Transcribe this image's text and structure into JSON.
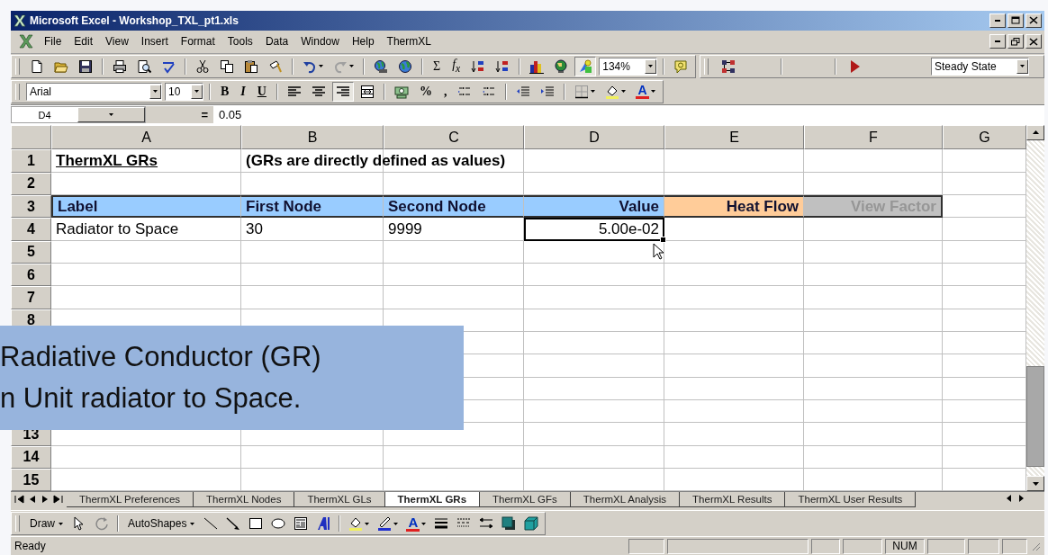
{
  "window": {
    "title": "Microsoft Excel - Workshop_TXL_pt1.xls"
  },
  "menu": [
    "File",
    "Edit",
    "View",
    "Insert",
    "Format",
    "Tools",
    "Data",
    "Window",
    "Help",
    "ThermXL"
  ],
  "standard_toolbar": {
    "sum": "Σ",
    "function": "f$_{x}$",
    "zoom": "134%",
    "drawing_on": true
  },
  "thermxl_toolbar": {
    "mode": "Steady State"
  },
  "formatting_toolbar": {
    "font": "Arial",
    "size": "10",
    "bold": "B",
    "italic": "I",
    "underline": "U",
    "percent": "%",
    "comma": ",",
    "font_color": "A",
    "align": [
      {
        "kind": "left",
        "selected": false
      },
      {
        "kind": "center",
        "selected": false
      },
      {
        "kind": "right",
        "selected": true
      }
    ]
  },
  "formula_bar": {
    "name_box": "D4",
    "equals": "=",
    "formula": "0.05"
  },
  "sheet": {
    "columns": [
      "A",
      "B",
      "C",
      "D",
      "E",
      "F",
      "G"
    ],
    "rows": [
      {
        "label": "1",
        "cells": [
          {
            "text": "ThermXL GRs",
            "kind": "title",
            "selected": false
          },
          {
            "text": "(GRs are directly defined as values)",
            "kind": "note",
            "selected": false
          },
          null,
          null,
          null,
          null,
          null
        ]
      },
      {
        "label": "2"
      },
      {
        "label": "3",
        "cells": [
          {
            "text": "Label",
            "kind": "header",
            "color": "#99ccff",
            "disabled": false,
            "selected": false
          },
          {
            "text": "First Node",
            "kind": "header",
            "color": "#99ccff",
            "disabled": false,
            "selected": false
          },
          {
            "text": "Second Node",
            "kind": "header",
            "color": "#99ccff",
            "disabled": false,
            "selected": false
          },
          {
            "text": "Value",
            "kind": "value-header",
            "color": "#99ccff",
            "disabled": false,
            "selected": false
          },
          {
            "text": "Heat Flow",
            "kind": "value-header",
            "color": "#ffcc99",
            "disabled": false,
            "selected": false
          },
          {
            "text": "View Factor",
            "kind": "value-header",
            "color": "#c0c0c0",
            "disabled": true,
            "selected": false
          },
          null
        ]
      },
      {
        "label": "4",
        "cells": [
          {
            "text": "Radiator to Space",
            "kind": "text",
            "selected": false
          },
          {
            "text": "30",
            "kind": "text",
            "selected": false
          },
          {
            "text": "9999",
            "kind": "text",
            "selected": false
          },
          {
            "text": "5.00e-02",
            "kind": "number",
            "selected": true
          },
          null,
          null,
          null
        ]
      },
      {
        "label": "5"
      },
      {
        "label": "6"
      },
      {
        "label": "7"
      },
      {
        "label": "8"
      },
      {},
      {},
      {},
      {},
      {
        "label": "13"
      },
      {
        "label": "14"
      },
      {
        "label": "15"
      }
    ]
  },
  "sheet_tabs": [
    {
      "label": "ThermXL Preferences",
      "selected": false
    },
    {
      "label": "ThermXL Nodes",
      "selected": false
    },
    {
      "label": "ThermXL GLs",
      "selected": false
    },
    {
      "label": "ThermXL GRs",
      "selected": true
    },
    {
      "label": "ThermXL GFs",
      "selected": false
    },
    {
      "label": "ThermXL Analysis",
      "selected": false
    },
    {
      "label": "ThermXL Results",
      "selected": false
    },
    {
      "label": "ThermXL User Results",
      "selected": false
    }
  ],
  "draw_toolbar": {
    "draw": "Draw",
    "autoshapes": "AutoShapes",
    "font_color": "A"
  },
  "status_bar": {
    "text": "Ready",
    "indicators": [
      "NUM"
    ]
  },
  "callout": {
    "lines": [
      "Radiative Conductor (GR)",
      "n Unit radiator to Space."
    ]
  }
}
